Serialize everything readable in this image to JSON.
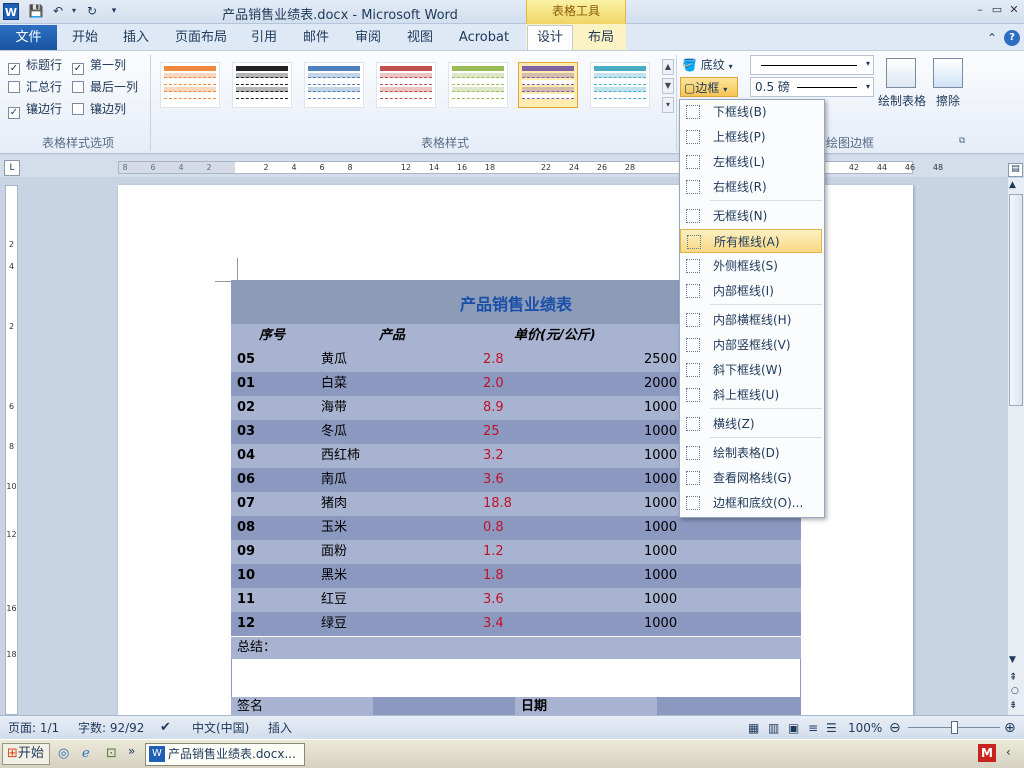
{
  "window": {
    "app_icon": "W",
    "title": "产品销售业绩表.docx - Microsoft Word",
    "tools_tab_header": "表格工具",
    "controls": [
      "–",
      "▭",
      "✕"
    ]
  },
  "ribbon_tabs": {
    "file": "文件",
    "tabs": [
      "开始",
      "插入",
      "页面布局",
      "引用",
      "邮件",
      "审阅",
      "视图",
      "Acrobat"
    ],
    "design": "设计",
    "layout": "布局"
  },
  "style_options": {
    "items": [
      {
        "label": "标题行",
        "checked": true
      },
      {
        "label": "第一列",
        "checked": true
      },
      {
        "label": "汇总行",
        "checked": false
      },
      {
        "label": "最后一列",
        "checked": false
      },
      {
        "label": "镶边行",
        "checked": true
      },
      {
        "label": "镶边列",
        "checked": false
      }
    ],
    "group_label": "表格样式选项"
  },
  "table_styles": {
    "group_label": "表格样式",
    "thumb_colors": [
      "#f0883e",
      "#222222",
      "#4f81bd",
      "#c0504d",
      "#9bbb59",
      "#8064a2",
      "#4bacc6"
    ]
  },
  "border_group": {
    "shading": "底纹",
    "borders": "边框",
    "pen_weight": "0.5 磅",
    "draw_table": "绘制表格",
    "eraser": "擦除",
    "group_label": "绘图边框"
  },
  "ruler": {
    "h_ticks": [
      "8",
      "6",
      "4",
      "2",
      "2",
      "4",
      "6",
      "8",
      "12",
      "14",
      "16",
      "18",
      "22",
      "24",
      "26",
      "28",
      "42",
      "44",
      "46",
      "48"
    ],
    "v_ticks": [
      "2",
      "4",
      "2",
      "6",
      "8",
      "10",
      "12",
      "16",
      "18"
    ]
  },
  "document_table": {
    "title": "产品销售业绩表",
    "headers": [
      "序号",
      "产品",
      "单价(元/公斤)"
    ],
    "rows": [
      {
        "no": "05",
        "product": "黄瓜",
        "price": "2.8",
        "qty": "2500"
      },
      {
        "no": "01",
        "product": "白菜",
        "price": "2.0",
        "qty": "2000"
      },
      {
        "no": "02",
        "product": "海带",
        "price": "8.9",
        "qty": "1000"
      },
      {
        "no": "03",
        "product": "冬瓜",
        "price": "25",
        "qty": "1000"
      },
      {
        "no": "04",
        "product": "西红柿",
        "price": "3.2",
        "qty": "1000"
      },
      {
        "no": "06",
        "product": "南瓜",
        "price": "3.6",
        "qty": "1000"
      },
      {
        "no": "07",
        "product": "猪肉",
        "price": "18.8",
        "qty": "1000"
      },
      {
        "no": "08",
        "product": "玉米",
        "price": "0.8",
        "qty": "1000"
      },
      {
        "no": "09",
        "product": "面粉",
        "price": "1.2",
        "qty": "1000"
      },
      {
        "no": "10",
        "product": "黑米",
        "price": "1.8",
        "qty": "1000"
      },
      {
        "no": "11",
        "product": "红豆",
        "price": "3.6",
        "qty": "1000"
      },
      {
        "no": "12",
        "product": "绿豆",
        "price": "3.4",
        "qty": "1000"
      }
    ],
    "summary": "总结：",
    "sign": "签名",
    "date": "日期"
  },
  "border_menu": {
    "items": [
      {
        "label": "下框线(B)",
        "icon": "border-bottom"
      },
      {
        "label": "上框线(P)",
        "icon": "border-top"
      },
      {
        "label": "左框线(L)",
        "icon": "border-left"
      },
      {
        "label": "右框线(R)",
        "icon": "border-right"
      },
      {
        "label": "无框线(N)",
        "icon": "border-none"
      },
      {
        "label": "所有框线(A)",
        "icon": "border-all",
        "highlighted": true
      },
      {
        "label": "外侧框线(S)",
        "icon": "border-outside"
      },
      {
        "label": "内部框线(I)",
        "icon": "border-inside"
      },
      {
        "label": "内部横框线(H)",
        "icon": "border-inside-horizontal"
      },
      {
        "label": "内部竖框线(V)",
        "icon": "border-inside-vertical"
      },
      {
        "label": "斜下框线(W)",
        "icon": "diagonal-down"
      },
      {
        "label": "斜上框线(U)",
        "icon": "diagonal-up"
      },
      {
        "label": "横线(Z)",
        "icon": "horizontal-line"
      },
      {
        "label": "绘制表格(D)",
        "icon": "draw-table"
      },
      {
        "label": "查看网格线(G)",
        "icon": "view-gridlines"
      },
      {
        "label": "边框和底纹(O)...",
        "icon": "borders-and-shading"
      }
    ]
  },
  "statusbar": {
    "page": "页面: 1/1",
    "words": "字数: 92/92",
    "language": "中文(中国)",
    "mode": "插入",
    "zoom": "100%"
  },
  "taskbar": {
    "start": "开始",
    "active_window": "产品销售业绩表.docx..."
  }
}
